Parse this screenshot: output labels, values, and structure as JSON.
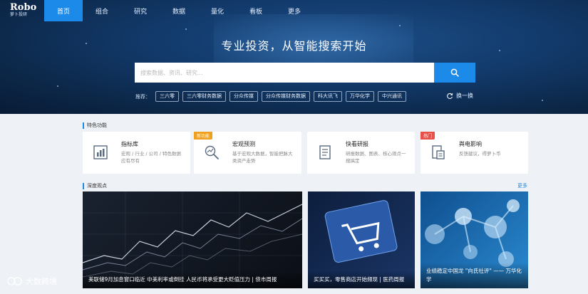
{
  "nav": {
    "logo_text": "Robo",
    "logo_subtext": "萝卜投研",
    "items": [
      {
        "label": "首页",
        "active": true
      },
      {
        "label": "组合"
      },
      {
        "label": "研究"
      },
      {
        "label": "数据"
      },
      {
        "label": "量化"
      },
      {
        "label": "看板"
      },
      {
        "label": "更多"
      }
    ]
  },
  "hero": {
    "headline": "专业投资，从智能搜索开始",
    "search": {
      "placeholder": "搜索数据、资讯、研究...",
      "value": "",
      "button_icon": "search-icon"
    },
    "recommend_label": "推荐：",
    "recommend_tags": [
      "三六零",
      "三六零财务数据",
      "分众传媒",
      "分众传媒财务数据",
      "科大讯飞",
      "万华化学",
      "中兴通讯"
    ],
    "refresh_label": "换一换"
  },
  "features": {
    "title": "特色功能",
    "cards": [
      {
        "title": "指标库",
        "desc": "宏观 / 行业 / 公司 / 特色数据应有尽有",
        "icon": "bar-chart-icon",
        "badge": ""
      },
      {
        "title": "宏观预测",
        "desc": "基于宏观大数据，智能把脉大类资产走势",
        "icon": "magnifier-chart-icon",
        "badge": "新功能"
      },
      {
        "title": "快看研报",
        "desc": "研报数据、图表、核心观点一搜搞定",
        "icon": "document-icon",
        "badge": ""
      },
      {
        "title": "舆电影响",
        "desc": "反馈建议，得萝卜币",
        "icon": "report-icon",
        "badge": "热门"
      }
    ]
  },
  "news": {
    "title": "深度观点",
    "more_label": "更多",
    "items": [
      {
        "caption": "美联储9月加息窗口临近 中美利率或倒挂 人民币将承受更大贬值压力 | 债市周报"
      },
      {
        "caption": "买买买，零售商店开始频现 | 医药周报"
      },
      {
        "caption": "业绩稳定中国龙 \"向氏社评\" —— 万华化学"
      }
    ]
  },
  "watermark": {
    "text": "大数跨境"
  },
  "colors": {
    "accent": "#1c8ae8",
    "hero_dark": "#0c2748",
    "badge_orange": "#f0a020",
    "badge_red": "#e8504a"
  }
}
